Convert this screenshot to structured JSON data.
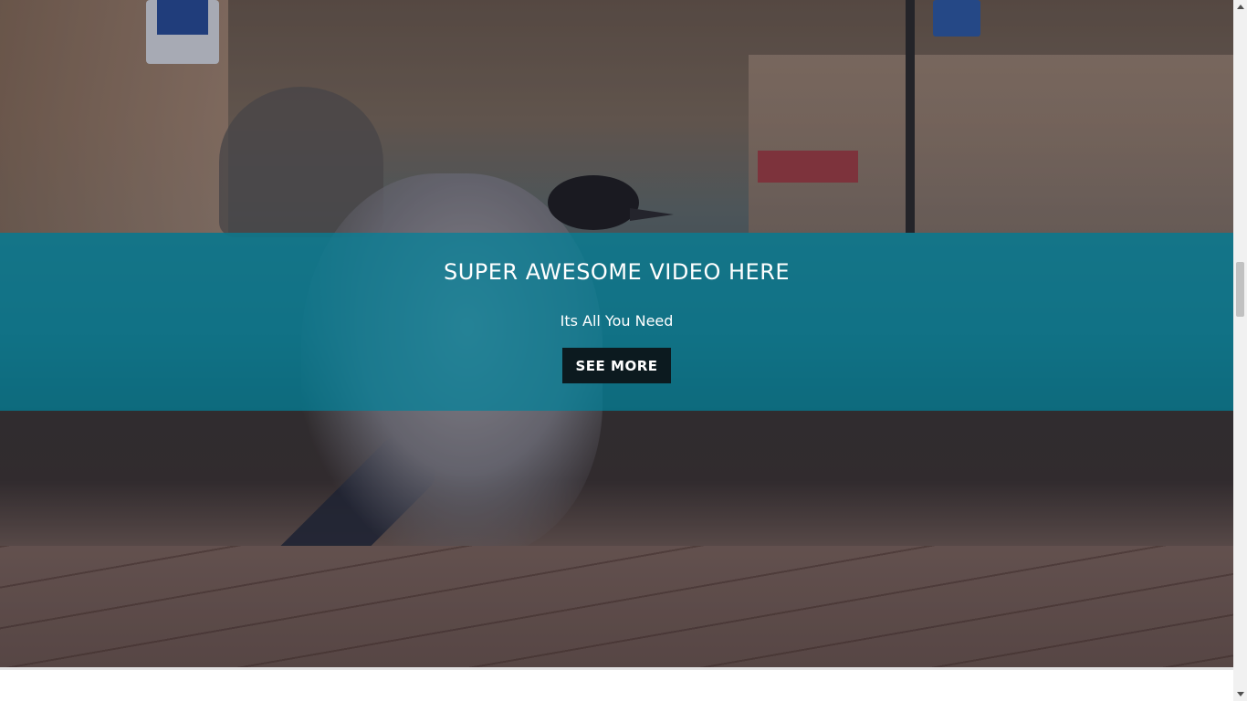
{
  "hero": {
    "background_description_icon": "crow-photo",
    "banner": {
      "title": "SUPER AWESOME VIDEO HERE",
      "subtitle": "Its All You Need",
      "button_label": "SEE MORE",
      "background_color": "#00829b"
    }
  },
  "colors": {
    "button_bg": "#0c1a1f",
    "text": "#ffffff"
  }
}
